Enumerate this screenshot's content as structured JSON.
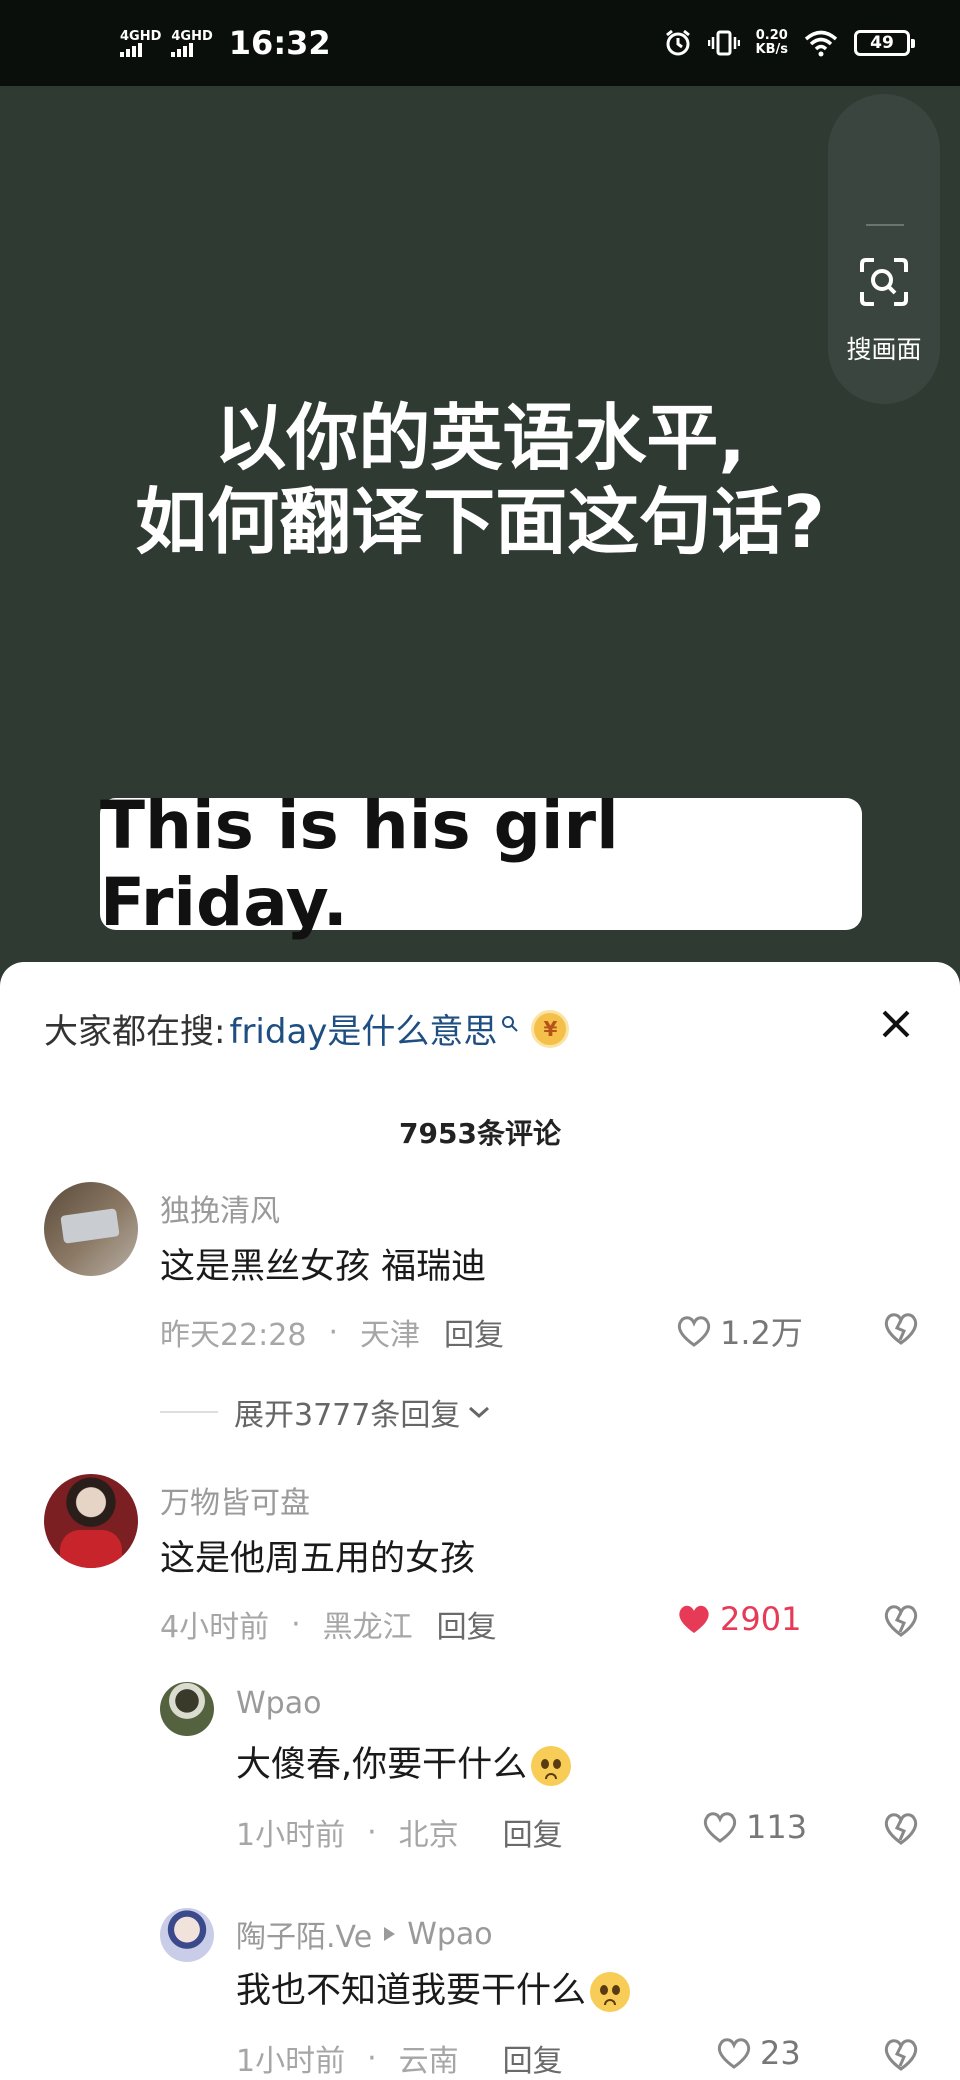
{
  "status_bar": {
    "signal_1": "4GHD",
    "signal_2": "4GHD",
    "time": "16:32",
    "net_speed_value": "0.20",
    "net_speed_unit": "KB/s",
    "battery": "49"
  },
  "video": {
    "search_button_label": "搜画面",
    "headline_line1": "以你的英语水平,",
    "headline_line2": "如何翻译下面这句话?",
    "quote": "This is his girl Friday."
  },
  "comments_panel": {
    "trending_prefix": "大家都在搜:",
    "trending_query": "friday是什么意思",
    "coin_symbol": "¥",
    "count_label": "7953条评论",
    "comments": [
      {
        "user": "独挽清风",
        "text": "这是黑丝女孩 福瑞迪",
        "time": "昨天22:28",
        "location": "天津",
        "reply": "回复",
        "likes": "1.2万",
        "liked": false,
        "expand": "展开3777条回复"
      },
      {
        "user": "万物皆可盘",
        "text": "这是他周五用的女孩",
        "time": "4小时前",
        "location": "黑龙江",
        "reply": "回复",
        "likes": "2901",
        "liked": true
      }
    ],
    "replies": [
      {
        "user": "Wpao",
        "text": "大傻春,你要干什么",
        "time": "1小时前",
        "location": "北京",
        "reply": "回复",
        "likes": "113"
      },
      {
        "user": "陶子陌.Ve",
        "reply_to": "Wpao",
        "text": "我也不知道我要干什么",
        "time": "1小时前",
        "location": "云南",
        "reply": "回复",
        "likes": "23"
      }
    ]
  },
  "colors": {
    "video_bg": "#2f3a33",
    "like_active": "#e63a57",
    "trending_link": "#1f4f82"
  }
}
